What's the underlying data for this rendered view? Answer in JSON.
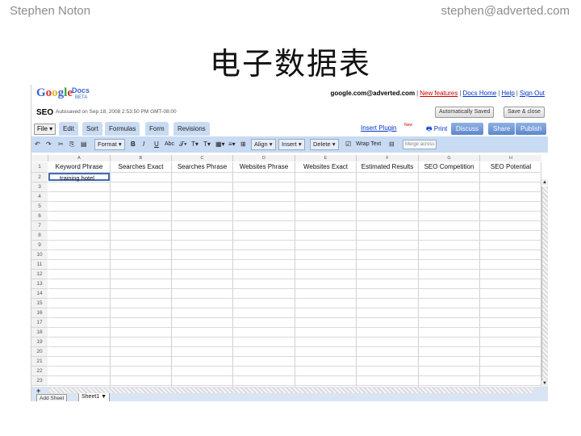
{
  "slide": {
    "author": "Stephen Noton",
    "email": "stephen@adverted.com",
    "title": "电子数据表"
  },
  "app": {
    "logo": [
      "G",
      "o",
      "o",
      "g",
      "l",
      "e"
    ],
    "logo_docs": "Docs",
    "logo_beta": "BETA",
    "top_links": {
      "account": "google.com@adverted.com",
      "new_features": "New features",
      "docs_home": "Docs Home",
      "help": "Help",
      "sign_out": "Sign Out"
    },
    "doc_name": "SEO",
    "saved_status": "Autosaved on Sep 18, 2008 2:53:50 PM GMT-08:00",
    "auto_saved_btn": "Automatically Saved",
    "save_close_btn": "Save & close"
  },
  "menubar": {
    "file": "File",
    "tabs": [
      "Edit",
      "Sort",
      "Formulas",
      "Form",
      "Revisions"
    ],
    "insert_plugin": "Insert Plugin",
    "new_tag": "New",
    "print": "Print",
    "buttons": [
      "Discuss",
      "Share",
      "Publish"
    ]
  },
  "toolbar": {
    "format": "Format",
    "bold": "B",
    "italic": "I",
    "underline": "U",
    "abc": "Abc",
    "align": "Align",
    "insert": "Insert",
    "delete": "Delete",
    "wrap_text": "Wrap Text",
    "merge": "Merge across"
  },
  "grid": {
    "columns": [
      "A",
      "B",
      "C",
      "D",
      "E",
      "F",
      "G",
      "H"
    ],
    "fields": [
      "Keyword Phrase",
      "Searches Exact",
      "Searches Phrase",
      "Websites Phrase",
      "Websites Exact",
      "Estimated Results",
      "SEO Competition",
      "SEO Potential"
    ],
    "rows": [
      "1",
      "2",
      "3",
      "4",
      "5",
      "6",
      "7",
      "8",
      "9",
      "10",
      "11",
      "12",
      "13",
      "14",
      "15",
      "16",
      "17",
      "18",
      "19",
      "20",
      "21",
      "22",
      "23"
    ],
    "selected_cell_value": "training hotel"
  },
  "bottom": {
    "add_sheet": "Add Sheet",
    "sheet_tab": "Sheet1 ▼"
  },
  "colors": {
    "toolbar_bg": "#c9dbf3",
    "selection": "#4169b8",
    "button_blue": "#5c86cc"
  }
}
